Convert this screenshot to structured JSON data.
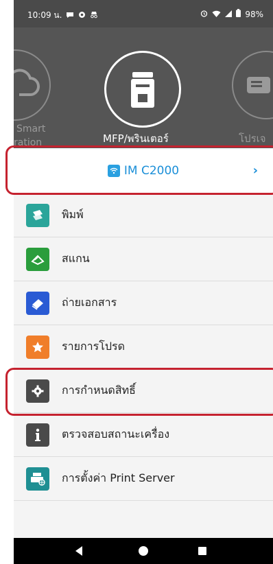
{
  "status_bar": {
    "time": "10:09 น.",
    "battery": "98%"
  },
  "header": {
    "left_label_line1": "Smart",
    "left_label_line2": "ration",
    "center_label": "MFP/พรินเตอร์",
    "right_label": "โปรเจ"
  },
  "device": {
    "name": "IM C2000",
    "chevron": "›"
  },
  "menu": {
    "items": [
      {
        "label": "พิมพ์",
        "icon": "print-icon"
      },
      {
        "label": "สแกน",
        "icon": "scan-icon"
      },
      {
        "label": "ถ่ายเอกสาร",
        "icon": "copy-icon"
      },
      {
        "label": "รายการโปรด",
        "icon": "star-icon"
      },
      {
        "label": "การกำหนดสิทธิ์",
        "icon": "gear-icon"
      },
      {
        "label": "ตรวจสอบสถานะเครื่อง",
        "icon": "info-icon"
      },
      {
        "label": "การตั้งค่า Print Server",
        "icon": "print-server-icon"
      }
    ]
  },
  "colors": {
    "accent": "#1b8fd8",
    "highlight": "#c5222f",
    "header_bg": "#555555"
  }
}
